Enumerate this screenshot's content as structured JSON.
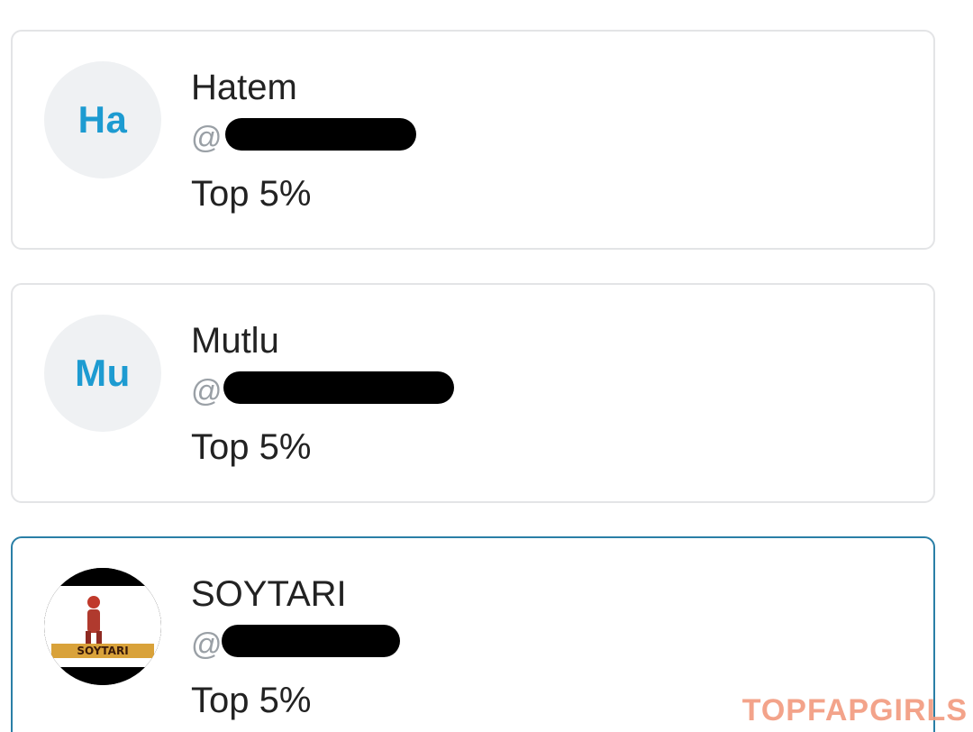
{
  "cards": [
    {
      "avatar_initials": "Ha",
      "name": "Hatem",
      "handle_visible": "@",
      "rank": "Top 5%"
    },
    {
      "avatar_initials": "Mu",
      "name": "Mutlu",
      "handle_visible": "@",
      "rank": "Top 5%"
    },
    {
      "avatar_logo_text": "SOYTARI",
      "name": "SOYTARI",
      "handle_visible": "@",
      "rank": "Top 5%"
    }
  ],
  "watermark": "TOPFAPGIRLS",
  "colors": {
    "avatar_text": "#1d9bd1",
    "avatar_bg": "#eff1f3",
    "selected_border": "#2a7fa6",
    "watermark": "#f29a7e"
  }
}
